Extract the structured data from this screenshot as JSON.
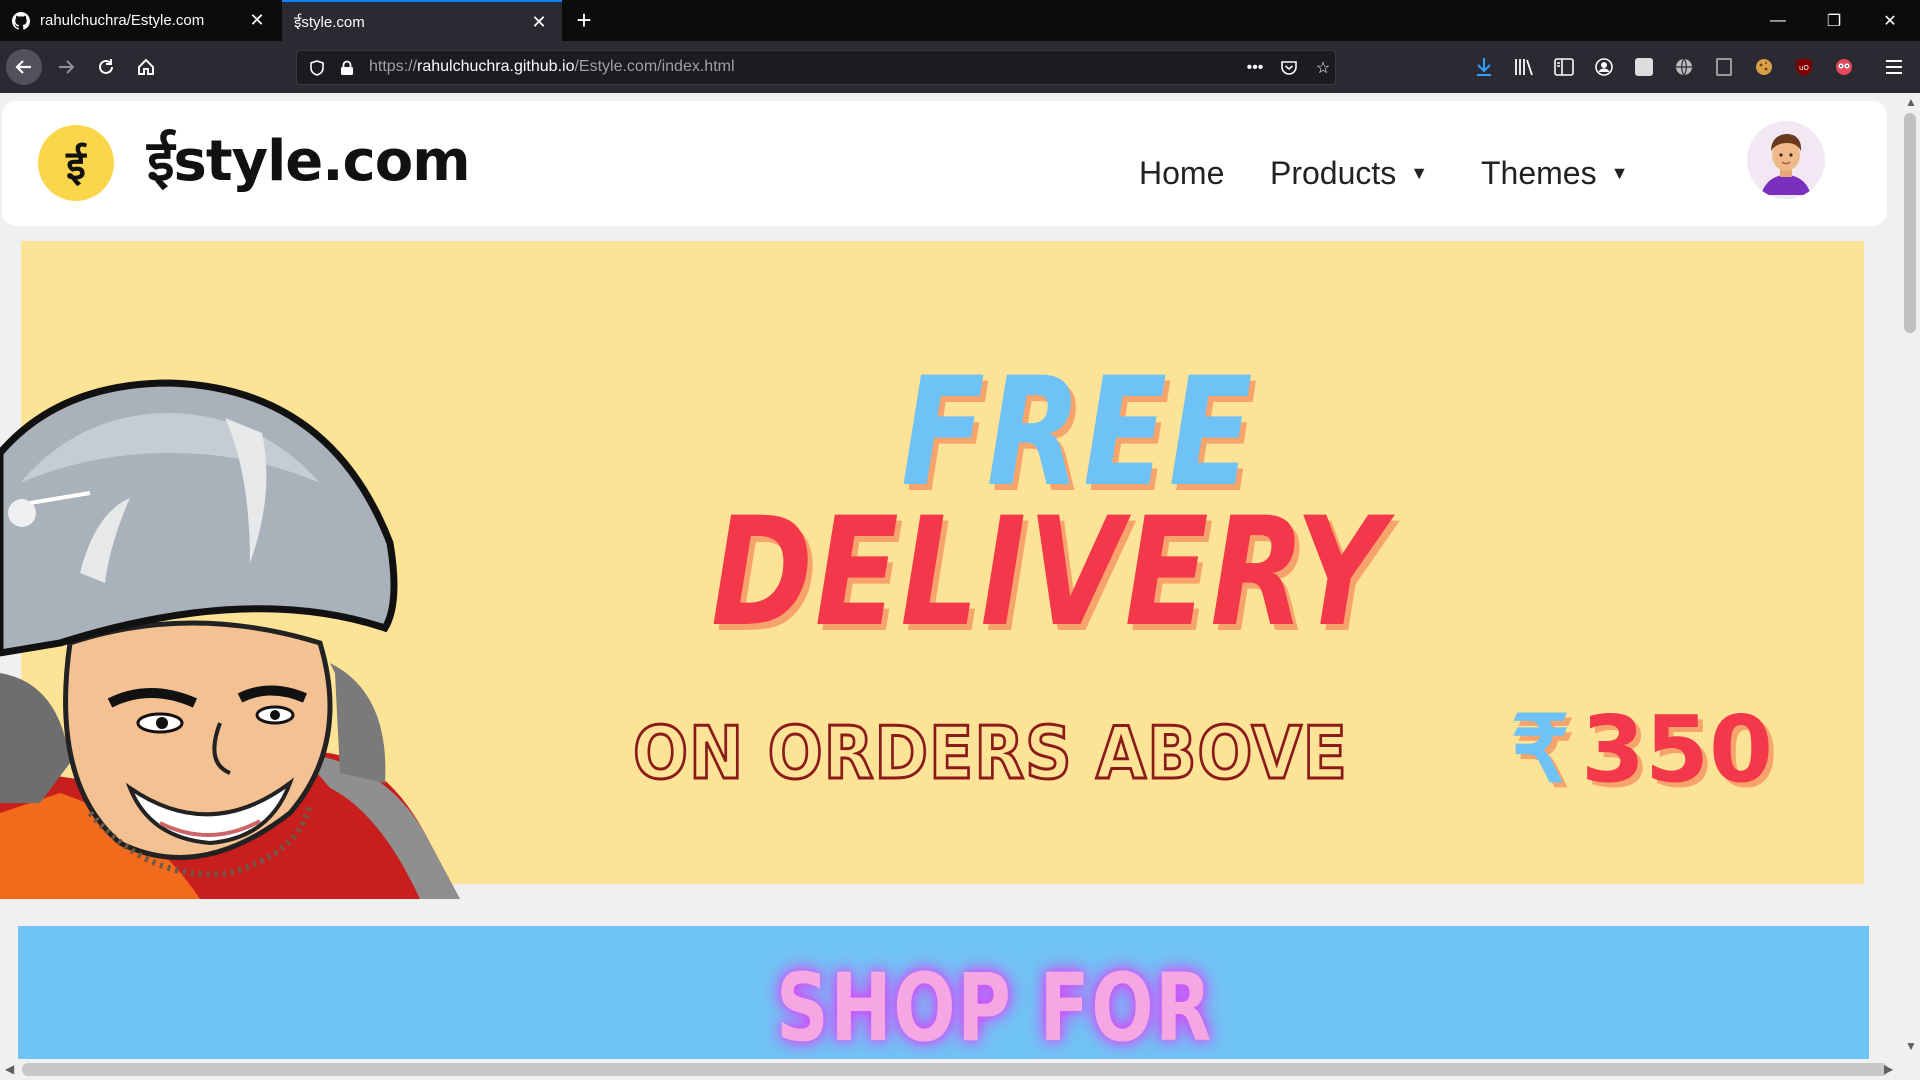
{
  "browser": {
    "tabs": [
      {
        "title": "rahulchuchra/Estyle.com",
        "icon": "github-icon",
        "active": false
      },
      {
        "title": "ईstyle.com",
        "icon": "site-favicon",
        "active": true
      }
    ],
    "url": {
      "scheme": "https://",
      "host": "rahulchuchra.github.io",
      "path": "/Estyle.com/index.html"
    },
    "toolbar_icons": [
      "download-icon",
      "library-icon",
      "sidebar-icon",
      "account-icon",
      "extension-icon",
      "globe-icon",
      "reader-icon",
      "cookie-icon",
      "ublock-icon",
      "privacy-icon",
      "menu-icon"
    ]
  },
  "site": {
    "logo_glyph": "ई",
    "brand": "ईstyle.com",
    "nav": [
      {
        "label": "Home",
        "has_dropdown": false
      },
      {
        "label": "Products",
        "has_dropdown": true
      },
      {
        "label": "Themes",
        "has_dropdown": true
      }
    ],
    "caret": "▼"
  },
  "banner": {
    "line1": "FREE",
    "line2": "DELIVERY",
    "line3": "ON ORDERS ABOVE",
    "currency": "₹",
    "amount": "350"
  },
  "shop": {
    "title": "SHOP FOR"
  },
  "colors": {
    "banner_bg": "#fde396",
    "free_blue": "#6ec2f5",
    "delivery_red": "#f2384a",
    "shop_bg": "#70c4f5",
    "logo_yellow": "#fbd64a"
  }
}
